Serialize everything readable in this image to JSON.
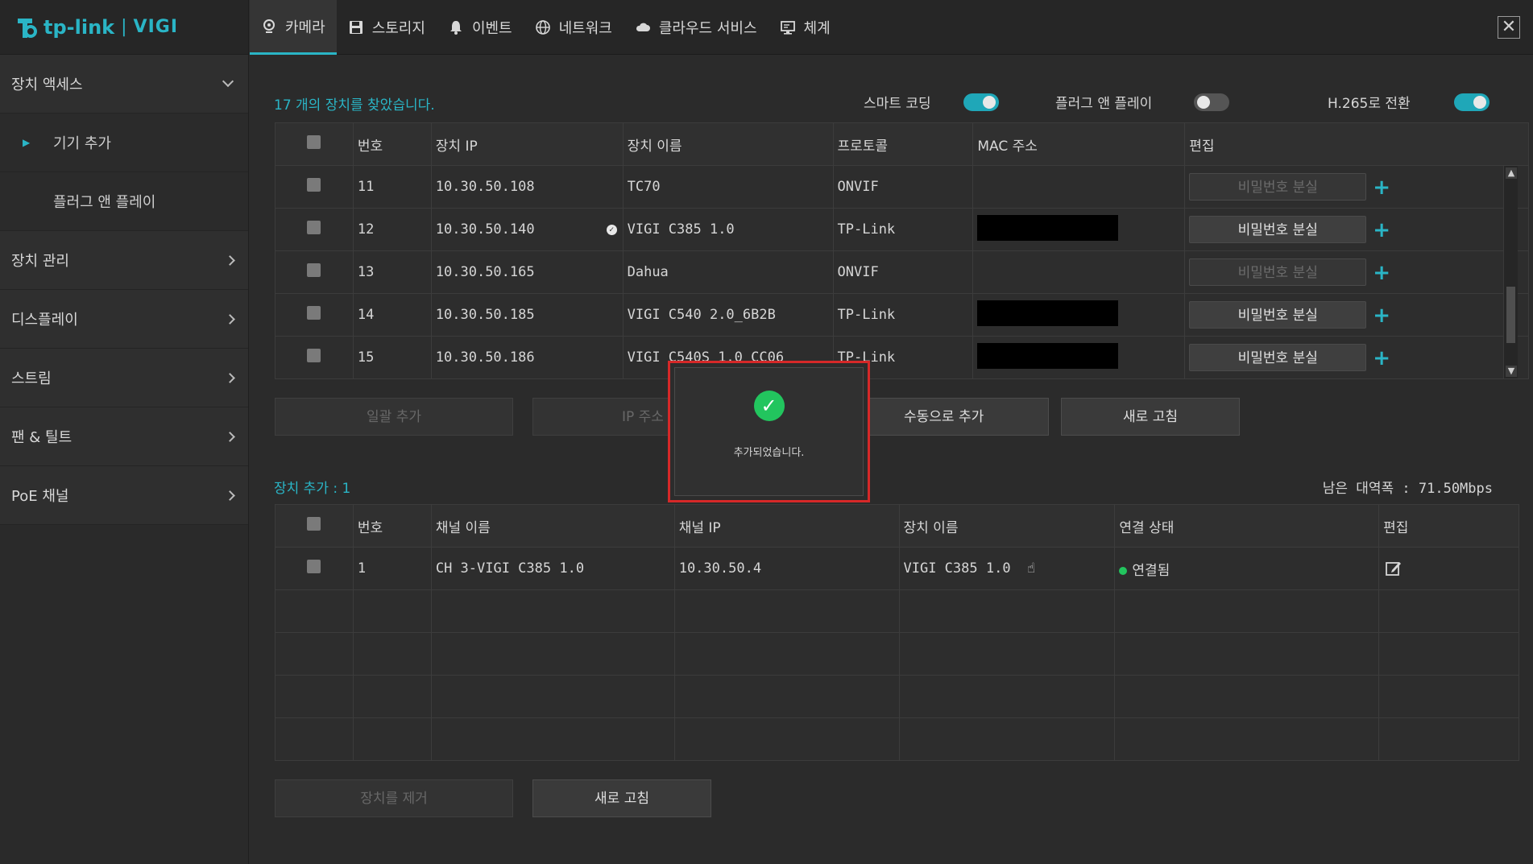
{
  "brand": {
    "logo_tp": "tp-link",
    "logo_sep": "|",
    "logo_vigi": "VIGI"
  },
  "sidebar": {
    "groups": [
      {
        "label": "장치 액세스",
        "expanded": true
      },
      {
        "label": "장치 관리"
      },
      {
        "label": "디스플레이"
      },
      {
        "label": "스트림"
      },
      {
        "label": "팬 & 틸트"
      },
      {
        "label": "PoE 채널"
      }
    ],
    "sub_items": [
      {
        "label": "기기 추가",
        "active": true
      },
      {
        "label": "플러그 앤 플레이"
      }
    ]
  },
  "topnav": {
    "tabs": [
      {
        "label": "카메라",
        "icon": "camera-icon",
        "active": true
      },
      {
        "label": "스토리지",
        "icon": "save-icon"
      },
      {
        "label": "이벤트",
        "icon": "bell-icon"
      },
      {
        "label": "네트워크",
        "icon": "globe-icon"
      },
      {
        "label": "클라우드 서비스",
        "icon": "cloud-icon"
      },
      {
        "label": "체계",
        "icon": "monitor-icon"
      }
    ],
    "close_label": "✕"
  },
  "discovery": {
    "found_text": "17 개의 장치를 찾았습니다.",
    "toggles": [
      {
        "label": "스마트 코딩",
        "on": true
      },
      {
        "label": "플러그 앤 플레이",
        "on": false
      },
      {
        "label": "H.265로 전환",
        "on": true
      }
    ],
    "headers": [
      "번호",
      "장치 IP",
      "장치 이름",
      "프로토콜",
      "MAC 주소",
      "편집"
    ],
    "rows": [
      {
        "no": "11",
        "ip": "10.30.50.108",
        "name": "TC70",
        "protocol": "ONVIF",
        "mac_redacted": false,
        "pw_enabled": false,
        "verified": false
      },
      {
        "no": "12",
        "ip": "10.30.50.140",
        "name": "VIGI C385 1.0",
        "protocol": "TP-Link",
        "mac_redacted": true,
        "pw_enabled": true,
        "verified": true
      },
      {
        "no": "13",
        "ip": "10.30.50.165",
        "name": "Dahua",
        "protocol": "ONVIF",
        "mac_redacted": false,
        "pw_enabled": false,
        "verified": false
      },
      {
        "no": "14",
        "ip": "10.30.50.185",
        "name": "VIGI C540 2.0_6B2B",
        "protocol": "TP-Link",
        "mac_redacted": true,
        "pw_enabled": true,
        "verified": false
      },
      {
        "no": "15",
        "ip": "10.30.50.186",
        "name": "VIGI C540S 1.0_CC06",
        "protocol": "TP-Link",
        "mac_redacted": true,
        "pw_enabled": true,
        "verified": false
      }
    ],
    "pw_label": "비밀번호 분실",
    "buttons": {
      "bulk_add": "일괄 추가",
      "ip_add": "IP 주소",
      "manual_add": "수동으로 추가",
      "refresh": "새로 고침"
    }
  },
  "added": {
    "count_text": "장치 추가 : 1",
    "bandwidth_text": "남은 대역폭 : 71.50Mbps",
    "headers": [
      "번호",
      "채널 이름",
      "채널 IP",
      "장치 이름",
      "연결 상태",
      "편집"
    ],
    "rows": [
      {
        "no": "1",
        "channel": "CH 3-VIGI C385 1.0",
        "ip": "10.30.50.4",
        "device": "VIGI C385 1.0",
        "status": "연결됨"
      }
    ],
    "buttons": {
      "remove": "장치를 제거",
      "refresh": "새로 고침"
    }
  },
  "popup": {
    "message": "추가되었습니다.",
    "icon": "check-circle-icon"
  },
  "colors": {
    "accent": "#2ab5c6",
    "success": "#22c55e",
    "highlight": "#d62828"
  }
}
